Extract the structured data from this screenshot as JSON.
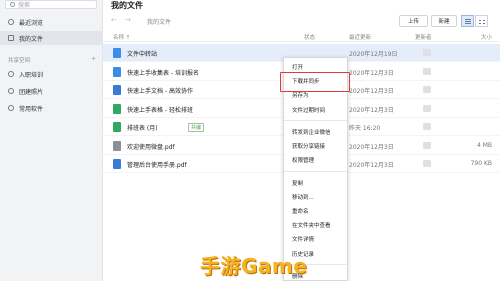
{
  "sidebar": {
    "search_placeholder": "搜索",
    "items": [
      {
        "label": "最近浏览",
        "icon": "clock-icon"
      },
      {
        "label": "我的文件",
        "icon": "folder-icon"
      }
    ],
    "shared_section": {
      "label": "共享空间",
      "add": "+"
    },
    "shared_items": [
      {
        "label": "入职培训",
        "icon": "group-icon"
      },
      {
        "label": "团建照片",
        "icon": "group-icon"
      },
      {
        "label": "常用软件",
        "icon": "group-icon"
      }
    ]
  },
  "header": {
    "title": "我的文件",
    "breadcrumb": "我的文件",
    "upload_label": "上传",
    "new_label": "新建"
  },
  "columns": {
    "name": "名称 ↑",
    "status": "状态",
    "updated": "最近更新",
    "updater": "更新者",
    "size": "大小"
  },
  "files": [
    {
      "name": "文件中转站",
      "date": "2020年12月19日",
      "size": "",
      "icon_color": "#3a8ee6",
      "tag": ""
    },
    {
      "name": "快速上手收集表 - 培训报名",
      "date": "2020年12月3日",
      "size": "",
      "icon_color": "#3a8ee6",
      "tag": ""
    },
    {
      "name": "快速上手文档 - 高效协作",
      "date": "2020年12月3日",
      "size": "",
      "icon_color": "#3a7bd5",
      "tag": ""
    },
    {
      "name": "快速上手表格 - 轻松排班",
      "date": "2020年12月3日",
      "size": "",
      "icon_color": "#2fa864",
      "tag": ""
    },
    {
      "name": "排班表 (月)",
      "date": "昨天 16:20",
      "size": "",
      "icon_color": "#2fa864",
      "tag": "共编"
    },
    {
      "name": "欢迎使用微盘.pdf",
      "date": "2020年12月3日",
      "size": "4 MB",
      "icon_color": "#8a8f98",
      "tag": ""
    },
    {
      "name": "管理后台使用手册.pdf",
      "date": "2020年12月3日",
      "size": "790 KB",
      "icon_color": "#3a7bd5",
      "tag": ""
    }
  ],
  "context_menu": {
    "items": [
      "打开",
      "下载并同步",
      "另存为",
      "文件过期时间",
      "转发到企业微信",
      "获取分享链接",
      "权限管理",
      "复制",
      "移动到...",
      "重命名",
      "在文件夹中查看",
      "文件详情",
      "历史记录",
      "删除"
    ],
    "highlighted": "下载并同步"
  },
  "watermark": "手游Game",
  "colors": {
    "accent": "#3a8ee6",
    "highlight": "#e03b3b",
    "selected_row": "#e4edf9",
    "watermark": "#f5b324"
  }
}
